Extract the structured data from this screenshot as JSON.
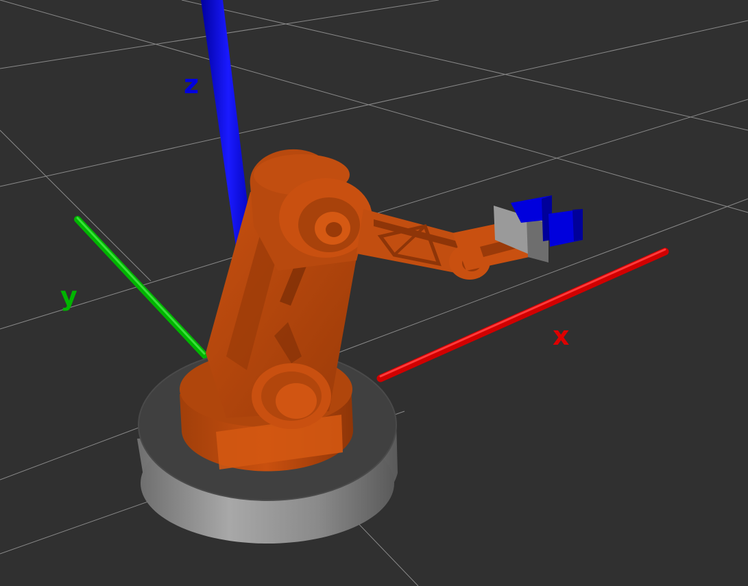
{
  "scene": {
    "background_color": "#303030",
    "grid_color": "#a0a0a0",
    "axes": {
      "x": {
        "label": "x",
        "color": "#dd0000"
      },
      "y": {
        "label": "y",
        "color": "#00b400"
      },
      "z": {
        "label": "z",
        "color": "#0000e0"
      }
    },
    "robot": {
      "body_color": "#c95010",
      "base_color": "#8a8a8a",
      "gripper_color": "#0000dd"
    }
  }
}
